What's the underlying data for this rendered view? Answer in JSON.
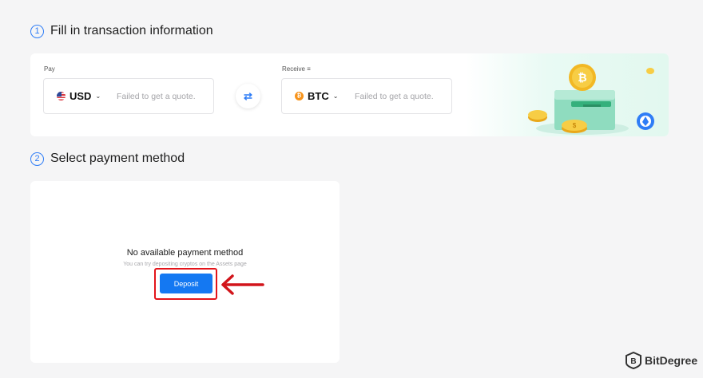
{
  "step1": {
    "number": "1",
    "title": "Fill in transaction information"
  },
  "pay": {
    "label": "Pay",
    "currency": "USD",
    "quote": "Failed to get a quote.",
    "flag_icon": "us-flag-icon"
  },
  "receive": {
    "label": "Receive ≡",
    "currency": "BTC",
    "quote": "Failed to get a quote.",
    "coin_icon": "btc-icon",
    "coin_symbol": "₿"
  },
  "swap_icon": "swap-arrows-icon",
  "step2": {
    "number": "2",
    "title": "Select payment method"
  },
  "payment": {
    "empty_title": "No available payment method",
    "empty_hint": "You can try depositing cryptos on the Assets page",
    "deposit_label": "Deposit"
  },
  "watermark": {
    "text": "BitDegree"
  },
  "colors": {
    "accent": "#1478f2",
    "highlight": "#e3141a",
    "bitcoin": "#f7931a",
    "background": "#f5f5f6"
  }
}
